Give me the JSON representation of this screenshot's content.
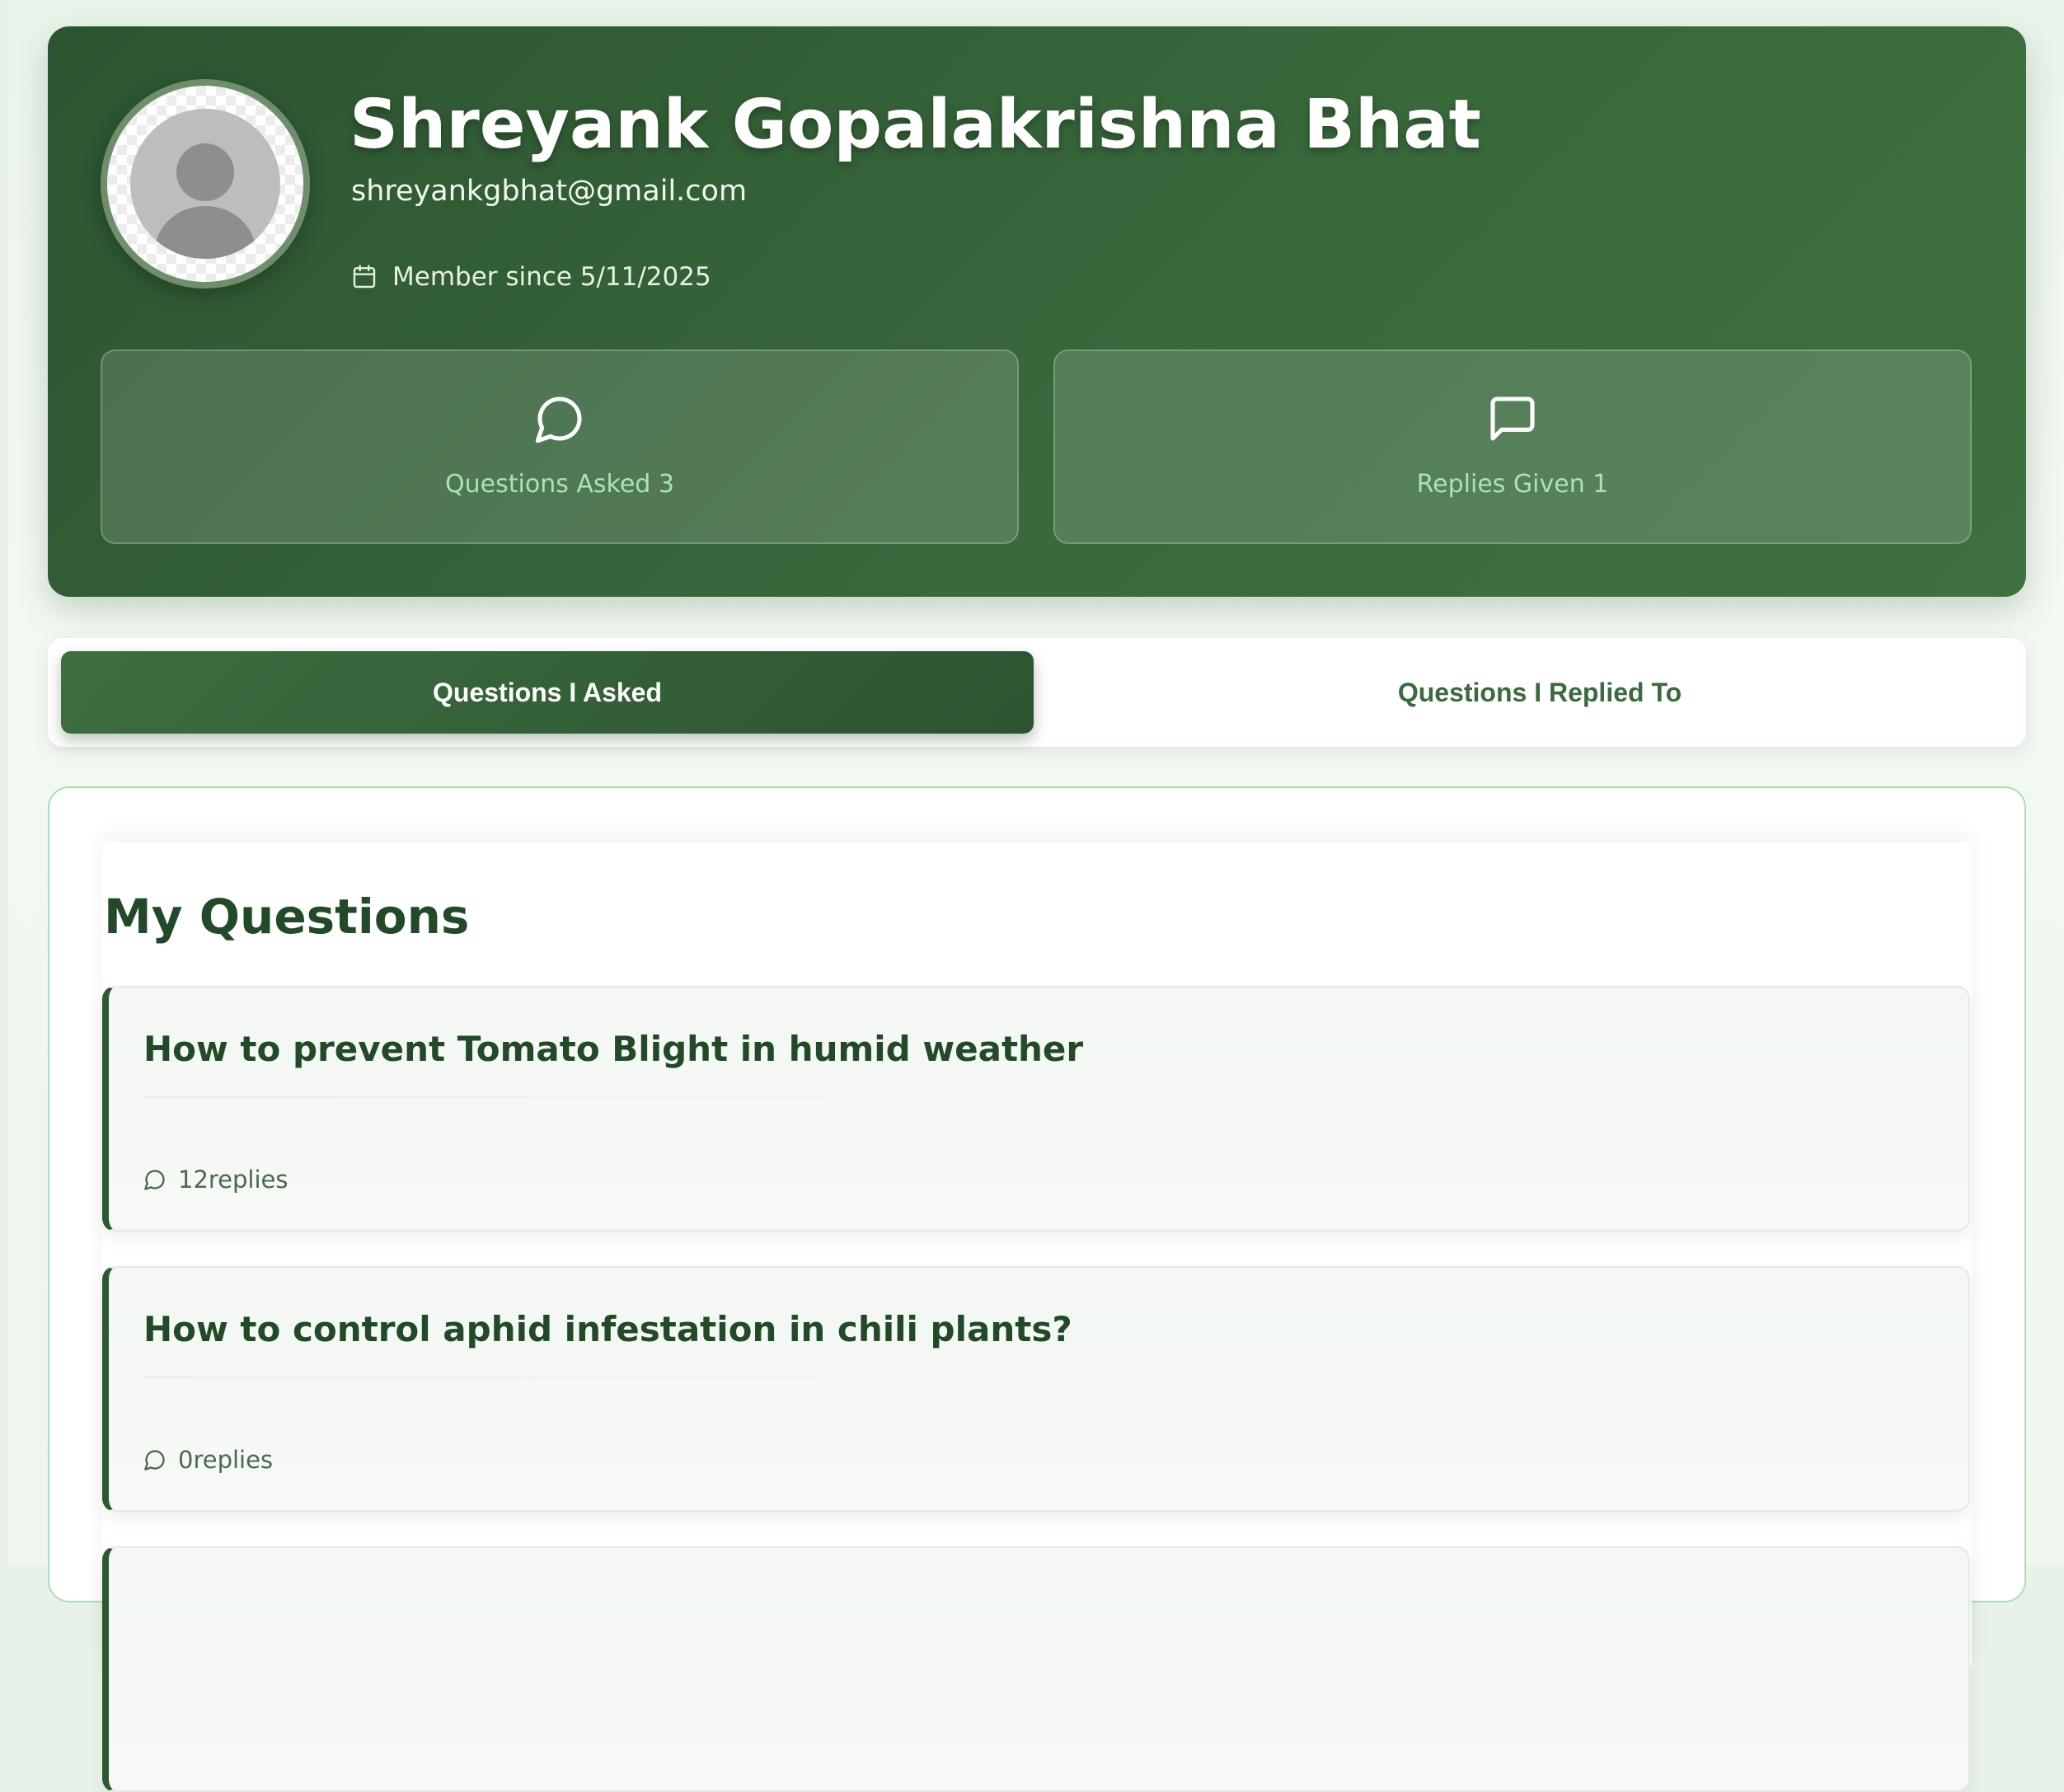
{
  "profile": {
    "name": "Shreyank Gopalakrishna Bhat",
    "email": "shreyankgbhat@gmail.com",
    "member_since": "Member since 5/11/2025"
  },
  "stats": [
    {
      "label": "Questions Asked 3",
      "icon": "message-circle-icon"
    },
    {
      "label": "Replies Given 1",
      "icon": "message-square-icon"
    }
  ],
  "tabs": [
    {
      "label": "Questions I Asked",
      "active": true
    },
    {
      "label": "Questions I Replied To",
      "active": false
    }
  ],
  "section": {
    "title": "My Questions"
  },
  "questions": [
    {
      "title": "How to prevent Tomato Blight in humid weather",
      "replies": "12replies"
    },
    {
      "title": "How to control aphid infestation in chili plants?",
      "replies": "0replies"
    },
    {
      "title": "",
      "replies": ""
    }
  ],
  "colors": {
    "header_green": "#2c5430",
    "accent_green": "#3e6e3f",
    "stat_label": "#a9e5b0",
    "title_green": "#234a28"
  }
}
